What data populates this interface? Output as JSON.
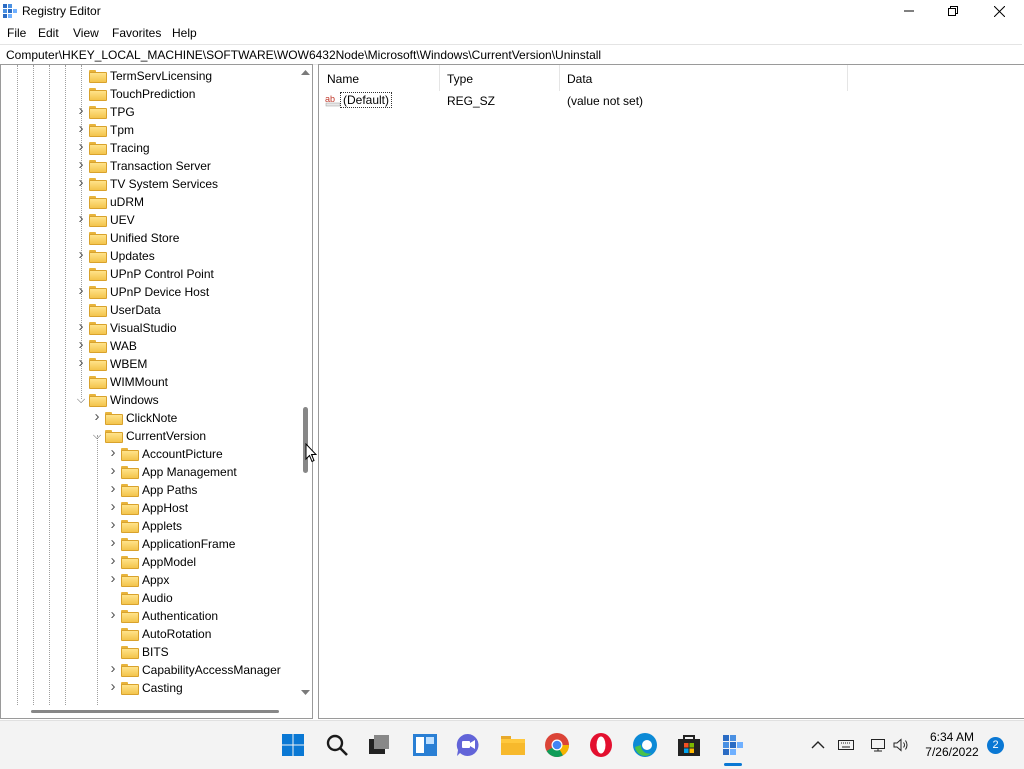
{
  "window": {
    "title": "Registry Editor"
  },
  "menu": [
    "File",
    "Edit",
    "View",
    "Favorites",
    "Help"
  ],
  "address": "Computer\\HKEY_LOCAL_MACHINE\\SOFTWARE\\WOW6432Node\\Microsoft\\Windows\\CurrentVersion\\Uninstall",
  "tree": [
    {
      "label": "TermServLicensing",
      "exp": false,
      "level": 0
    },
    {
      "label": "TouchPrediction",
      "exp": false,
      "level": 0
    },
    {
      "label": "TPG",
      "exp": "collapsed",
      "level": 0
    },
    {
      "label": "Tpm",
      "exp": "collapsed",
      "level": 0
    },
    {
      "label": "Tracing",
      "exp": "collapsed",
      "level": 0
    },
    {
      "label": "Transaction Server",
      "exp": "collapsed",
      "level": 0
    },
    {
      "label": "TV System Services",
      "exp": "collapsed",
      "level": 0
    },
    {
      "label": "uDRM",
      "exp": false,
      "level": 0
    },
    {
      "label": "UEV",
      "exp": "collapsed",
      "level": 0
    },
    {
      "label": "Unified Store",
      "exp": false,
      "level": 0
    },
    {
      "label": "Updates",
      "exp": "collapsed",
      "level": 0
    },
    {
      "label": "UPnP Control Point",
      "exp": false,
      "level": 0
    },
    {
      "label": "UPnP Device Host",
      "exp": "collapsed",
      "level": 0
    },
    {
      "label": "UserData",
      "exp": false,
      "level": 0
    },
    {
      "label": "VisualStudio",
      "exp": "collapsed",
      "level": 0
    },
    {
      "label": "WAB",
      "exp": "collapsed",
      "level": 0
    },
    {
      "label": "WBEM",
      "exp": "collapsed",
      "level": 0
    },
    {
      "label": "WIMMount",
      "exp": false,
      "level": 0
    },
    {
      "label": "Windows",
      "exp": "expanded",
      "level": 0
    },
    {
      "label": "ClickNote",
      "exp": "collapsed",
      "level": 1
    },
    {
      "label": "CurrentVersion",
      "exp": "expanded",
      "level": 1
    },
    {
      "label": "AccountPicture",
      "exp": "collapsed",
      "level": 2
    },
    {
      "label": "App Management",
      "exp": "collapsed",
      "level": 2
    },
    {
      "label": "App Paths",
      "exp": "collapsed",
      "level": 2
    },
    {
      "label": "AppHost",
      "exp": "collapsed",
      "level": 2
    },
    {
      "label": "Applets",
      "exp": "collapsed",
      "level": 2
    },
    {
      "label": "ApplicationFrame",
      "exp": "collapsed",
      "level": 2
    },
    {
      "label": "AppModel",
      "exp": "collapsed",
      "level": 2
    },
    {
      "label": "Appx",
      "exp": "collapsed",
      "level": 2
    },
    {
      "label": "Audio",
      "exp": false,
      "level": 2
    },
    {
      "label": "Authentication",
      "exp": "collapsed",
      "level": 2
    },
    {
      "label": "AutoRotation",
      "exp": false,
      "level": 2
    },
    {
      "label": "BITS",
      "exp": false,
      "level": 2
    },
    {
      "label": "CapabilityAccessManager",
      "exp": "collapsed",
      "level": 2
    },
    {
      "label": "Casting",
      "exp": "collapsed",
      "level": 2
    }
  ],
  "columns": {
    "name": "Name",
    "type": "Type",
    "data": "Data"
  },
  "values": [
    {
      "name": "(Default)",
      "type": "REG_SZ",
      "data": "(value not set)",
      "icon": "ab"
    }
  ],
  "taskbar": {
    "apps": [
      "windows-start-icon",
      "search-icon",
      "task-view-icon",
      "widgets-icon",
      "chat-icon",
      "file-explorer-icon",
      "chrome-icon",
      "opera-icon",
      "edge-icon",
      "store-icon",
      "registry-editor-icon"
    ],
    "time": "6:34 AM",
    "date": "7/26/2022",
    "notifications": "2"
  }
}
